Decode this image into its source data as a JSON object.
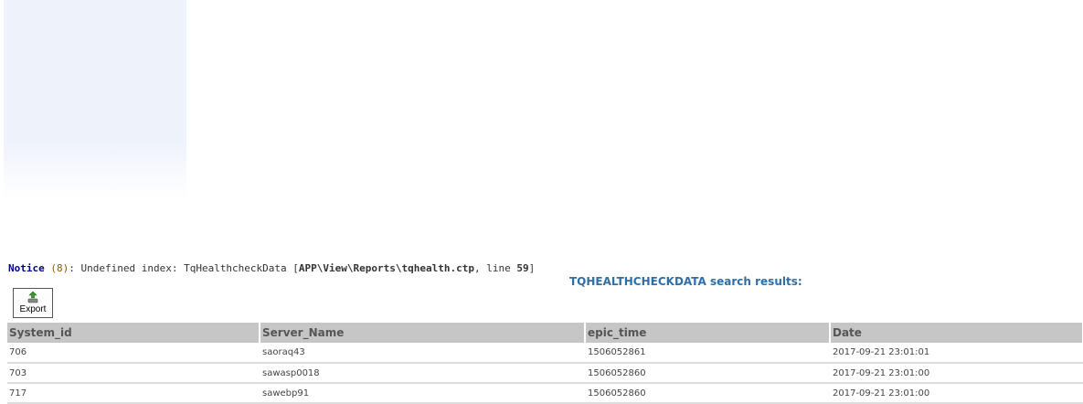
{
  "notice": {
    "level": "Notice",
    "code": "(8)",
    "message": ": Undefined index: TqHealthcheckData [",
    "file": "APP\\View\\Reports\\tqhealth.ctp",
    "line_label": ", line ",
    "line": "59",
    "close": "]"
  },
  "results_title": "TQHEALTHCHECKDATA search results:",
  "export": {
    "label": "Export",
    "icon": "export-icon"
  },
  "table": {
    "columns": [
      "System_id",
      "Server_Name",
      "epic_time",
      "Date"
    ],
    "rows": [
      [
        "706",
        "saoraq43",
        "1506052861",
        "2017-09-21 23:01:01"
      ],
      [
        "703",
        "sawasp0018",
        "1506052860",
        "2017-09-21 23:01:00"
      ],
      [
        "717",
        "sawebp91",
        "1506052860",
        "2017-09-21 23:01:00"
      ]
    ]
  }
}
